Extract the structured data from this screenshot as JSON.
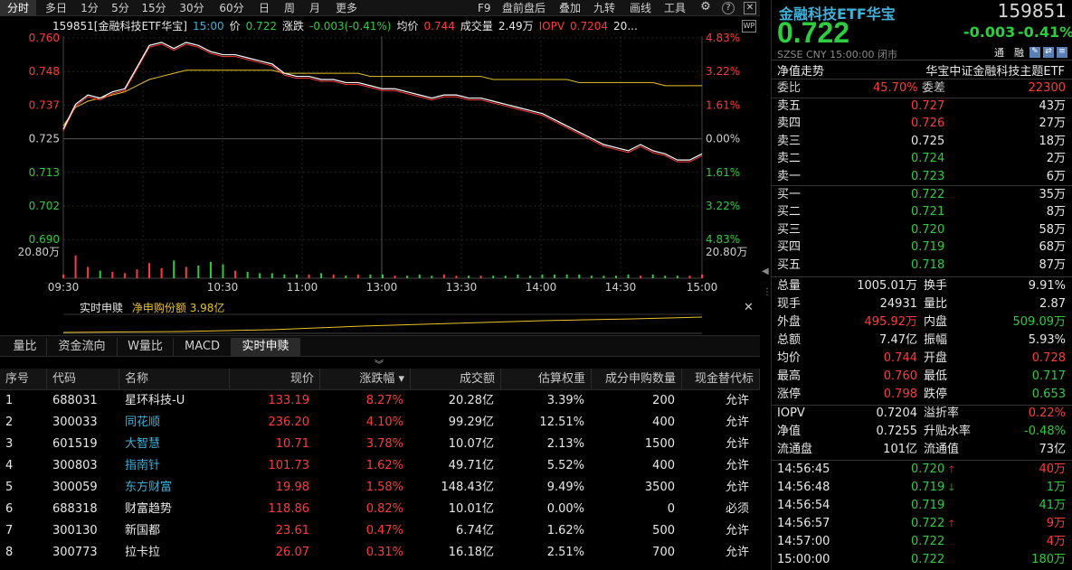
{
  "topbar": {
    "tabs": [
      "分时",
      "多日",
      "1分",
      "5分",
      "15分",
      "30分",
      "60分",
      "日",
      "周",
      "月",
      "更多"
    ],
    "active_tab": "分时",
    "right_tabs": [
      "F9",
      "盘前盘后",
      "叠加",
      "九转",
      "画线",
      "工具"
    ]
  },
  "chart_header": {
    "code_name": "159851[金融科技ETF华宝]",
    "time": "15:00",
    "price_label": "价",
    "price": "0.722",
    "change_label": "涨跌",
    "change": "-0.003(-0.41%)",
    "avg_label": "均价",
    "avg": "0.744",
    "volume_label": "成交量",
    "volume": "2.49万",
    "iopv_label": "IOPV",
    "iopv": "0.7204",
    "more": "20..."
  },
  "chart_data": {
    "type": "line",
    "x_ticks": [
      "09:30",
      "10:30",
      "11:00",
      "13:00",
      "13:30",
      "14:00",
      "14:30",
      "15:00"
    ],
    "y_left_ticks": [
      "0.760",
      "0.748",
      "0.737",
      "0.725",
      "0.713",
      "0.702",
      "0.690"
    ],
    "y_right_ticks": [
      "4.83%",
      "3.22%",
      "1.61%",
      "0.00%",
      "1.61%",
      "3.22%",
      "4.83%"
    ],
    "volume_tick": "20.80万",
    "prev_close": 0.725,
    "ylim": [
      0.69,
      0.76
    ],
    "price_series": [
      0.73,
      0.738,
      0.741,
      0.74,
      0.742,
      0.743,
      0.75,
      0.757,
      0.758,
      0.756,
      0.758,
      0.757,
      0.755,
      0.754,
      0.754,
      0.753,
      0.752,
      0.751,
      0.748,
      0.747,
      0.747,
      0.746,
      0.746,
      0.745,
      0.745,
      0.744,
      0.743,
      0.743,
      0.742,
      0.741,
      0.74,
      0.741,
      0.741,
      0.74,
      0.74,
      0.739,
      0.738,
      0.737,
      0.736,
      0.735,
      0.733,
      0.731,
      0.729,
      0.727,
      0.725,
      0.724,
      0.723,
      0.725,
      0.723,
      0.722,
      0.72,
      0.72,
      0.722
    ],
    "avg_series": [
      0.731,
      0.737,
      0.739,
      0.74,
      0.741,
      0.742,
      0.744,
      0.746,
      0.747,
      0.748,
      0.749,
      0.749,
      0.749,
      0.749,
      0.749,
      0.749,
      0.749,
      0.749,
      0.748,
      0.748,
      0.748,
      0.748,
      0.748,
      0.748,
      0.748,
      0.747,
      0.747,
      0.747,
      0.747,
      0.747,
      0.747,
      0.747,
      0.747,
      0.747,
      0.747,
      0.746,
      0.746,
      0.746,
      0.746,
      0.746,
      0.746,
      0.746,
      0.745,
      0.745,
      0.745,
      0.745,
      0.745,
      0.745,
      0.745,
      0.744,
      0.744,
      0.744,
      0.744
    ],
    "volume_series": [
      3,
      18,
      9,
      6,
      5,
      4,
      7,
      12,
      8,
      14,
      9,
      10,
      13,
      11,
      6,
      5,
      4,
      4,
      3,
      3,
      3,
      4,
      3,
      2,
      3,
      3,
      3,
      2,
      2,
      3,
      2,
      3,
      2,
      2,
      2,
      2,
      2,
      3,
      2,
      3,
      3,
      3,
      3,
      2,
      2,
      2,
      3,
      2,
      3,
      2,
      2,
      2,
      3
    ]
  },
  "subpanel": {
    "title": "实时申赎",
    "metric_label": "净申购份额",
    "metric_value": "3.98亿",
    "close_icon": "close-icon"
  },
  "subtabs": [
    "量比",
    "资金流向",
    "W量比",
    "MACD",
    "实时申赎"
  ],
  "subtab_active": "实时申赎",
  "table": {
    "headers": [
      "序号",
      "代码",
      "名称",
      "现价",
      "涨跌幅 ▾",
      "成交额",
      "估算权重",
      "成分申购数量",
      "现金替代标"
    ],
    "rows": [
      [
        "1",
        "688031",
        "星环科技-U",
        "133.19",
        "8.27%",
        "20.28亿",
        "3.39%",
        "200",
        "允许"
      ],
      [
        "2",
        "300033",
        "同花顺",
        "236.20",
        "4.10%",
        "99.29亿",
        "12.51%",
        "400",
        "允许"
      ],
      [
        "3",
        "601519",
        "大智慧",
        "10.71",
        "3.78%",
        "10.07亿",
        "2.13%",
        "1500",
        "允许"
      ],
      [
        "4",
        "300803",
        "指南针",
        "101.73",
        "1.62%",
        "49.71亿",
        "5.52%",
        "400",
        "允许"
      ],
      [
        "5",
        "300059",
        "东方财富",
        "19.98",
        "1.58%",
        "148.43亿",
        "9.49%",
        "3500",
        "允许"
      ],
      [
        "6",
        "688318",
        "财富趋势",
        "118.86",
        "0.82%",
        "10.01亿",
        "0.00%",
        "0",
        "必须"
      ],
      [
        "7",
        "300130",
        "新国都",
        "23.61",
        "0.47%",
        "6.74亿",
        "1.62%",
        "500",
        "允许"
      ],
      [
        "8",
        "300773",
        "拉卡拉",
        "26.07",
        "0.31%",
        "16.18亿",
        "2.51%",
        "700",
        "允许"
      ]
    ],
    "name_cyan": [
      false,
      true,
      true,
      true,
      true,
      false,
      false,
      false
    ]
  },
  "right": {
    "name": "金融科技ETF华宝",
    "code": "159851",
    "price": "0.722",
    "change": "-0.003",
    "change_pct": "-0.41%",
    "tags": [
      "通",
      "融"
    ],
    "sub": "SZSE  CNY  15:00:00  闭市",
    "nav_trend": "净值走势",
    "index_name": "华宝中证金融科技主题ETF",
    "weibi_label": "委比",
    "weibi": "45.70%",
    "weicha_label": "委差",
    "weicha": "22300",
    "asks": [
      {
        "label": "卖五",
        "price": "0.727",
        "vol": "43万"
      },
      {
        "label": "卖四",
        "price": "0.726",
        "vol": "27万"
      },
      {
        "label": "卖三",
        "price": "0.725",
        "vol": "18万"
      },
      {
        "label": "卖二",
        "price": "0.724",
        "vol": "2万"
      },
      {
        "label": "卖一",
        "price": "0.723",
        "vol": "6万"
      }
    ],
    "bids": [
      {
        "label": "买一",
        "price": "0.722",
        "vol": "35万"
      },
      {
        "label": "买二",
        "price": "0.721",
        "vol": "8万"
      },
      {
        "label": "买三",
        "price": "0.720",
        "vol": "58万"
      },
      {
        "label": "买四",
        "price": "0.719",
        "vol": "68万"
      },
      {
        "label": "买五",
        "price": "0.718",
        "vol": "87万"
      }
    ],
    "stats": [
      [
        {
          "l": "总量",
          "v": "1005.01万",
          "c": "white"
        },
        {
          "l": "换手",
          "v": "9.91%",
          "c": "white"
        }
      ],
      [
        {
          "l": "现手",
          "v": "24931",
          "c": "white"
        },
        {
          "l": "量比",
          "v": "2.87",
          "c": "white"
        }
      ],
      [
        {
          "l": "外盘",
          "v": "495.92万",
          "c": "red"
        },
        {
          "l": "内盘",
          "v": "509.09万",
          "c": "green"
        }
      ],
      [
        {
          "l": "总额",
          "v": "7.47亿",
          "c": "white"
        },
        {
          "l": "振幅",
          "v": "5.93%",
          "c": "white"
        }
      ],
      [
        {
          "l": "均价",
          "v": "0.744",
          "c": "red"
        },
        {
          "l": "开盘",
          "v": "0.728",
          "c": "red"
        }
      ],
      [
        {
          "l": "最高",
          "v": "0.760",
          "c": "red"
        },
        {
          "l": "最低",
          "v": "0.717",
          "c": "green"
        }
      ],
      [
        {
          "l": "涨停",
          "v": "0.798",
          "c": "red"
        },
        {
          "l": "跌停",
          "v": "0.653",
          "c": "green"
        }
      ]
    ],
    "stats2": [
      [
        {
          "l": "IOPV",
          "v": "0.7204",
          "c": "white"
        },
        {
          "l": "溢折率",
          "v": "0.22%",
          "c": "red"
        }
      ],
      [
        {
          "l": "净值",
          "v": "0.7255",
          "c": "white"
        },
        {
          "l": "升贴水率",
          "v": "-0.48%",
          "c": "green"
        }
      ],
      [
        {
          "l": "流通盘",
          "v": "101亿",
          "c": "white"
        },
        {
          "l": "流通值",
          "v": "73亿",
          "c": "white"
        }
      ]
    ],
    "ticks": [
      {
        "t": "14:56:45",
        "p": "0.720",
        "dir": "up",
        "v": "40万",
        "vc": "red"
      },
      {
        "t": "14:56:48",
        "p": "0.719",
        "dir": "down",
        "v": "1万",
        "vc": "green"
      },
      {
        "t": "14:56:54",
        "p": "0.719",
        "dir": "",
        "v": "41万",
        "vc": "green"
      },
      {
        "t": "14:56:57",
        "p": "0.722",
        "dir": "up",
        "v": "9万",
        "vc": "red"
      },
      {
        "t": "14:57:00",
        "p": "0.722",
        "dir": "",
        "v": "4万",
        "vc": "red"
      },
      {
        "t": "15:00:00",
        "p": "0.722",
        "dir": "",
        "v": "180万",
        "vc": "green"
      }
    ]
  }
}
